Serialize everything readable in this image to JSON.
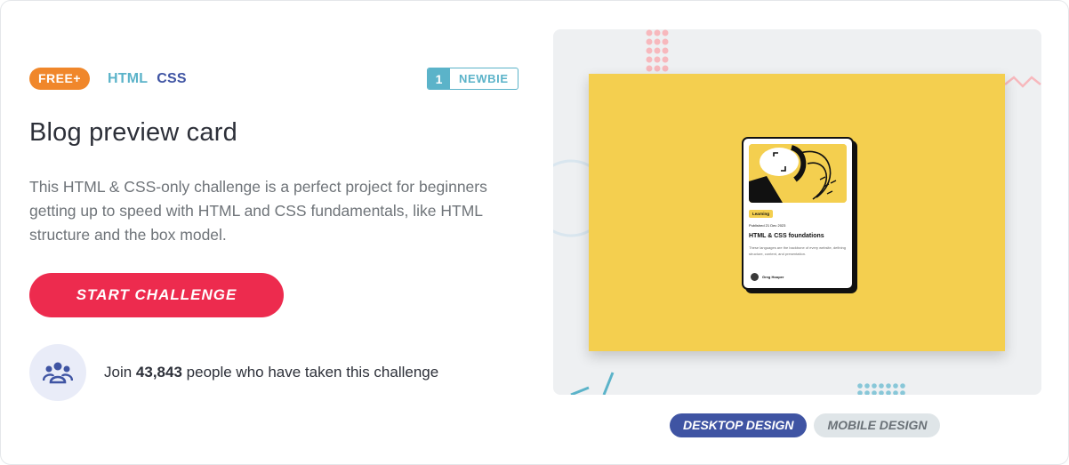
{
  "badges": {
    "free_label": "FREE+",
    "languages": [
      "HTML",
      "CSS"
    ],
    "level_number": "1",
    "level_name": "NEWBIE"
  },
  "challenge": {
    "title": "Blog preview card",
    "description": "This HTML & CSS-only challenge is a perfect project for beginners getting up to speed with HTML and CSS fundamentals, like HTML structure and the box model.",
    "cta_label": "START CHALLENGE"
  },
  "participants": {
    "prefix": "Join",
    "count": "43,843",
    "suffix": "people who have taken this challenge",
    "icon": "people-icon"
  },
  "preview": {
    "card": {
      "tag": "Learning",
      "date": "Published 21 Dec 2023",
      "title": "HTML & CSS foundations",
      "text": "These languages are the backbone of every website, defining structure, content, and presentation.",
      "author": "Greg Hooper"
    }
  },
  "tabs": [
    {
      "label": "DESKTOP DESIGN",
      "active": true
    },
    {
      "label": "MOBILE DESIGN",
      "active": false
    }
  ],
  "colors": {
    "accent": "#ed2b4e",
    "free": "#f0872b",
    "html": "#5bb3c9",
    "css": "#3f54a3",
    "preview_bg": "#f4cf4f"
  }
}
